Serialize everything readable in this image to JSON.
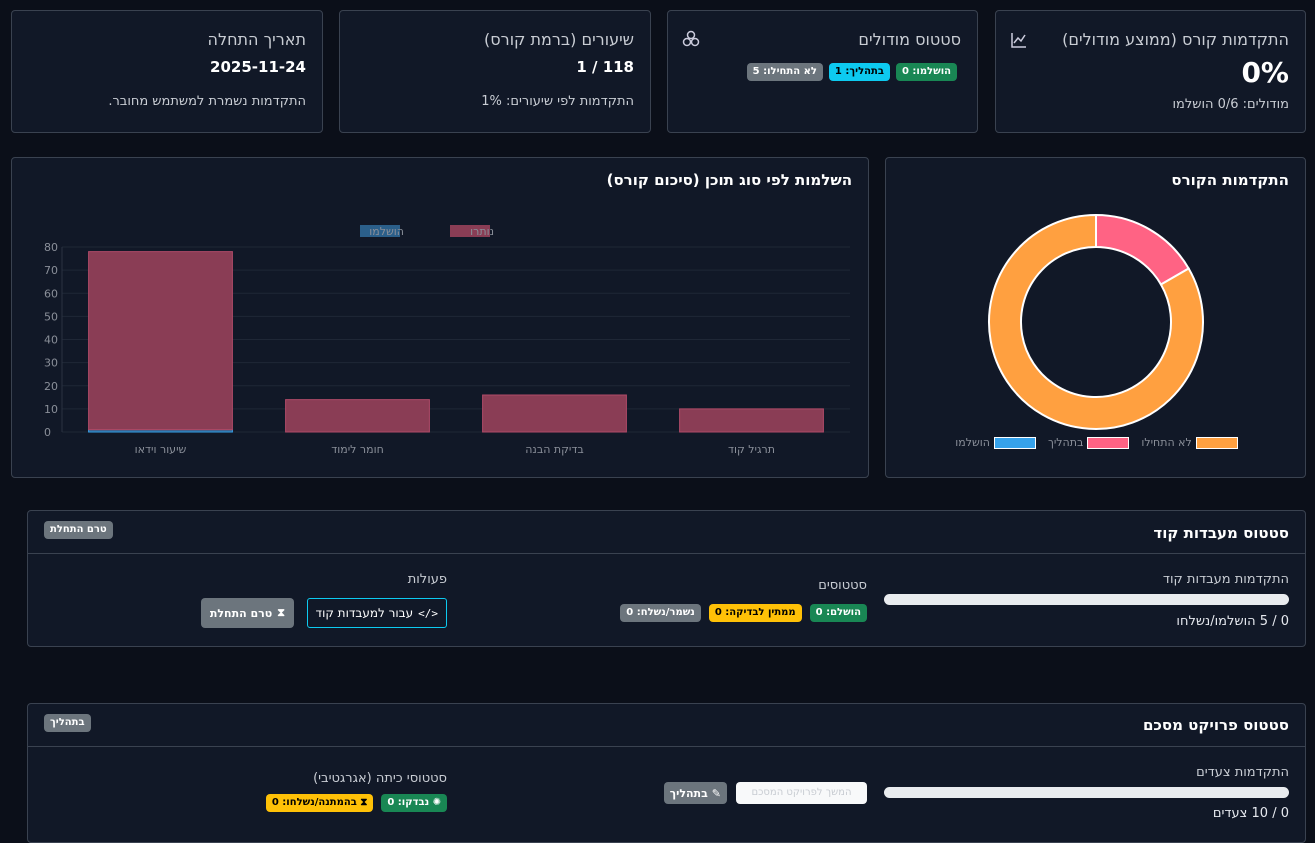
{
  "stats": {
    "progress": {
      "title": "התקדמות קורס (ממוצע מודולים)",
      "value": "0%",
      "sub": "מודולים: 0/6 הושלמו"
    },
    "modules": {
      "title": "סטטוס מודולים",
      "completed": "הושלמו: 0",
      "in_progress": "בתהליך: 1",
      "not_started": "לא התחילו: 5"
    },
    "lessons": {
      "title": "שיעורים (ברמת קורס)",
      "value": "1 / 118",
      "sub": "התקדמות לפי שיעורים: 1%"
    },
    "start": {
      "title": "תאריך התחלה",
      "value": "2025-11-24",
      "sub": "התקדמות נשמרת למשתמש מחובר."
    }
  },
  "donut": {
    "title": "התקדמות הקורס",
    "legend": [
      "לא התחילו",
      "בתהליך",
      "הושלמו"
    ]
  },
  "bar": {
    "title": "השלמות לפי סוג תוכן (סיכום קורס)"
  },
  "chart_data": [
    {
      "type": "pie",
      "labels": [
        "לא התחילו",
        "בתהליך",
        "הושלמו"
      ],
      "values": [
        5,
        1,
        0
      ],
      "colors": [
        "#ffa040",
        "#ff6384",
        "#36a2eb"
      ],
      "donut": true
    },
    {
      "type": "bar",
      "categories": [
        "שיעור וידאו",
        "חומר לימוד",
        "בדיקת הבנה",
        "תרגיל קוד"
      ],
      "series": [
        {
          "name": "הושלמו",
          "values": [
            1,
            0,
            0,
            0
          ],
          "color": "#2b5f8a"
        },
        {
          "name": "נותרו",
          "values": [
            77,
            14,
            16,
            10
          ],
          "color": "#8a3d55"
        }
      ],
      "stacked": true,
      "ylim": [
        0,
        80
      ],
      "yticks": [
        0,
        10,
        20,
        30,
        40,
        50,
        60,
        70,
        80
      ],
      "legend": "top-center",
      "grid": true
    }
  ],
  "labs": {
    "title": "סטטוס מעבדות קוד",
    "state_badge": "טרם התחלת",
    "progress_label": "התקדמות מעבדות קוד",
    "progress_fraction": 0,
    "progress_text": "0 / 5 הושלמו/נשלחו",
    "status_label": "סטטוסים",
    "done": "הושלם: 0",
    "waiting": "ממתין לבדיקה: 0",
    "saved": "נשמר/נשלח: 0",
    "actions_label": "פעולות",
    "go_button": "עבור למעבדות קוד",
    "not_started_button": "טרם התחלת"
  },
  "project": {
    "title": "סטטוס פרויקט מסכם",
    "state_badge": "בתהליך",
    "progress_label": "התקדמות צעדים",
    "progress_fraction": 0,
    "progress_text": "0 / 10 צעדים",
    "in_progress_button": "בתהליך",
    "white_button": "המשך לפרויקט המסכם",
    "class_status_label": "סטטוסי כיתה (אגרגטיבי)",
    "checked": "נבדקו: 0",
    "pending": "בהמתנה/נשלחו: 0"
  }
}
